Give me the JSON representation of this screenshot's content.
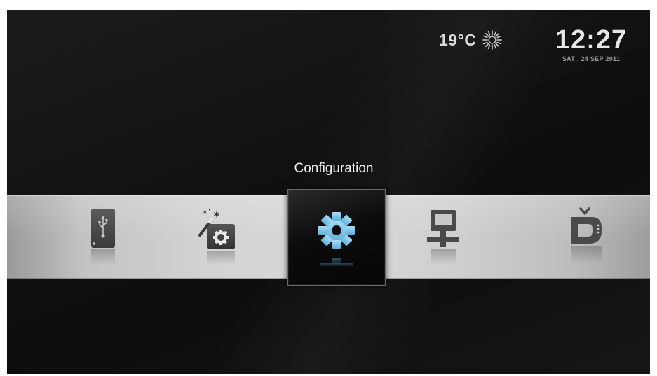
{
  "weather": {
    "temperature": "19°C",
    "icon": "sun-icon"
  },
  "clock": {
    "time": "12:27",
    "date": "SAT , 24 SEP 2011"
  },
  "menu": {
    "selected_label": "Configuration",
    "selected_index": 2,
    "items": [
      {
        "icon": "usb-drive-icon"
      },
      {
        "icon": "setup-wizard-icon"
      },
      {
        "icon": "gear-icon",
        "label": "Configuration"
      },
      {
        "icon": "network-computer-icon"
      },
      {
        "icon": "tv-logo-icon"
      }
    ]
  },
  "colors": {
    "accent": "#7ec8ec",
    "icon_gray": "#4a4a4a",
    "background": "#131313"
  }
}
